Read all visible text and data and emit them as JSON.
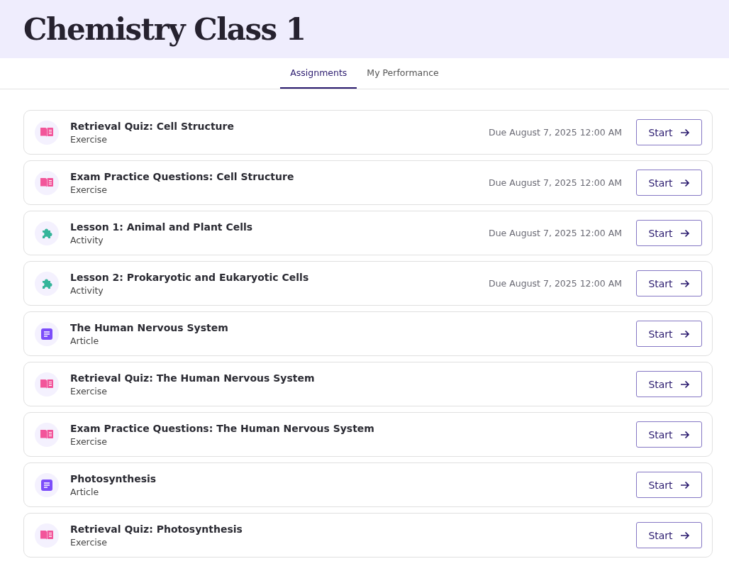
{
  "header": {
    "title": "Chemistry Class 1"
  },
  "tabs": [
    {
      "label": "Assignments",
      "selected": true
    },
    {
      "label": "My Performance",
      "selected": false
    }
  ],
  "assignments": [
    {
      "kind": "exercise",
      "title": "Retrieval Quiz: Cell Structure",
      "type": "Exercise",
      "due": "Due August 7, 2025 12:00 AM",
      "button": "Start"
    },
    {
      "kind": "exercise",
      "title": "Exam Practice Questions: Cell Structure",
      "type": "Exercise",
      "due": "Due August 7, 2025 12:00 AM",
      "button": "Start"
    },
    {
      "kind": "activity",
      "title": "Lesson 1: Animal and Plant Cells",
      "type": "Activity",
      "due": "Due August 7, 2025 12:00 AM",
      "button": "Start"
    },
    {
      "kind": "activity",
      "title": "Lesson 2: Prokaryotic and Eukaryotic Cells",
      "type": "Activity",
      "due": "Due August 7, 2025 12:00 AM",
      "button": "Start"
    },
    {
      "kind": "article",
      "title": "The Human Nervous System",
      "type": "Article",
      "button": "Start"
    },
    {
      "kind": "exercise",
      "title": "Retrieval Quiz: The Human Nervous System",
      "type": "Exercise",
      "button": "Start"
    },
    {
      "kind": "exercise",
      "title": "Exam Practice Questions: The Human Nervous System",
      "type": "Exercise",
      "button": "Start"
    },
    {
      "kind": "article",
      "title": "Photosynthesis",
      "type": "Article",
      "button": "Start"
    },
    {
      "kind": "exercise",
      "title": "Retrieval Quiz: Photosynthesis",
      "type": "Exercise",
      "button": "Start"
    }
  ]
}
